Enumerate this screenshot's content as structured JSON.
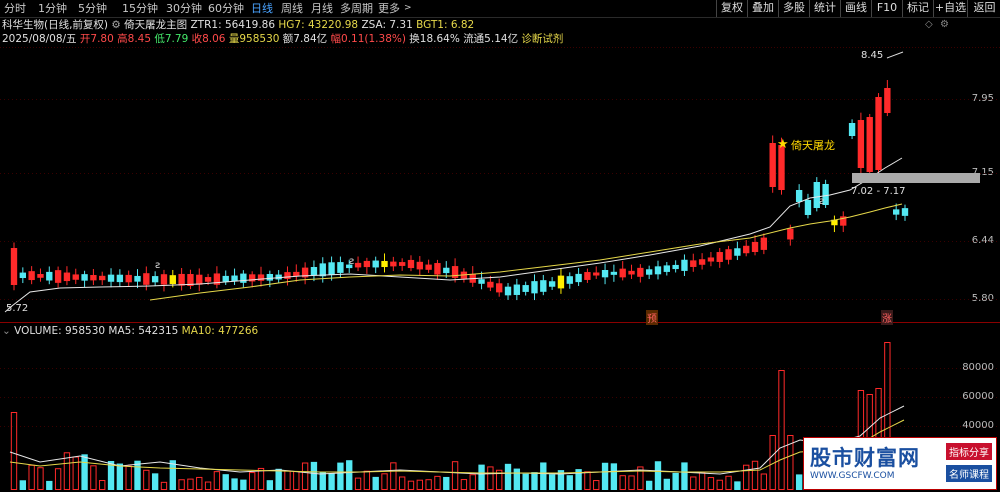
{
  "toolbar": {
    "timeframes": [
      "分时",
      "1分钟",
      "5分钟",
      "15分钟",
      "30分钟",
      "60分钟",
      "日线",
      "周线",
      "月线",
      "多周期",
      "更多"
    ],
    "active_timeframe": "日线",
    "right_buttons": [
      "复权",
      "叠加",
      "多股",
      "统计",
      "画线",
      "F10",
      "标记",
      "+自选",
      "返回"
    ]
  },
  "header": {
    "stock_name": "科华生物(日线,前复权)",
    "indicator_name": "倚天屠龙主图",
    "ztr1": "ZTR1: 56419.86",
    "hg7": "HG7: 43220.98",
    "zsa": "ZSA: 7.31",
    "bgt1": "BGT1: 6.82"
  },
  "quote": {
    "date": "2025/08/08/五",
    "open": "开7.80",
    "high": "高8.45",
    "low": "低7.79",
    "close": "收8.06",
    "volume": "量958530",
    "amount": "额7.84亿",
    "change": "幅0.11(1.38%)",
    "turnover": "换18.64%",
    "float_cap": "流通5.14亿",
    "diagnose": "诊断试剂"
  },
  "price_axis": [
    "7.95",
    "7.15",
    "6.44",
    "5.80"
  ],
  "annotations": {
    "high_label": "8.45",
    "low_label": "5.72",
    "signal_label": "倚天屠龙",
    "zone_label": "7.02 - 7.17",
    "marker_a": "预",
    "marker_b": "涨"
  },
  "volume_header": {
    "volume": "VOLUME: 958530",
    "ma5": "MA5: 542315",
    "ma10": "MA10: 477266"
  },
  "volume_axis": [
    "80000",
    "60000",
    "40000"
  ],
  "watermark": {
    "title": "股市财富网",
    "url": "WWW.GSCFW.COM",
    "tag1": "指标分享",
    "tag2": "名师课程"
  },
  "colors": {
    "up": "#ff2a2a",
    "down": "#54e8f2",
    "ma_white": "#e8e8e8",
    "ma_yellow": "#e6d84a",
    "accent": "#4aa3ff"
  }
}
